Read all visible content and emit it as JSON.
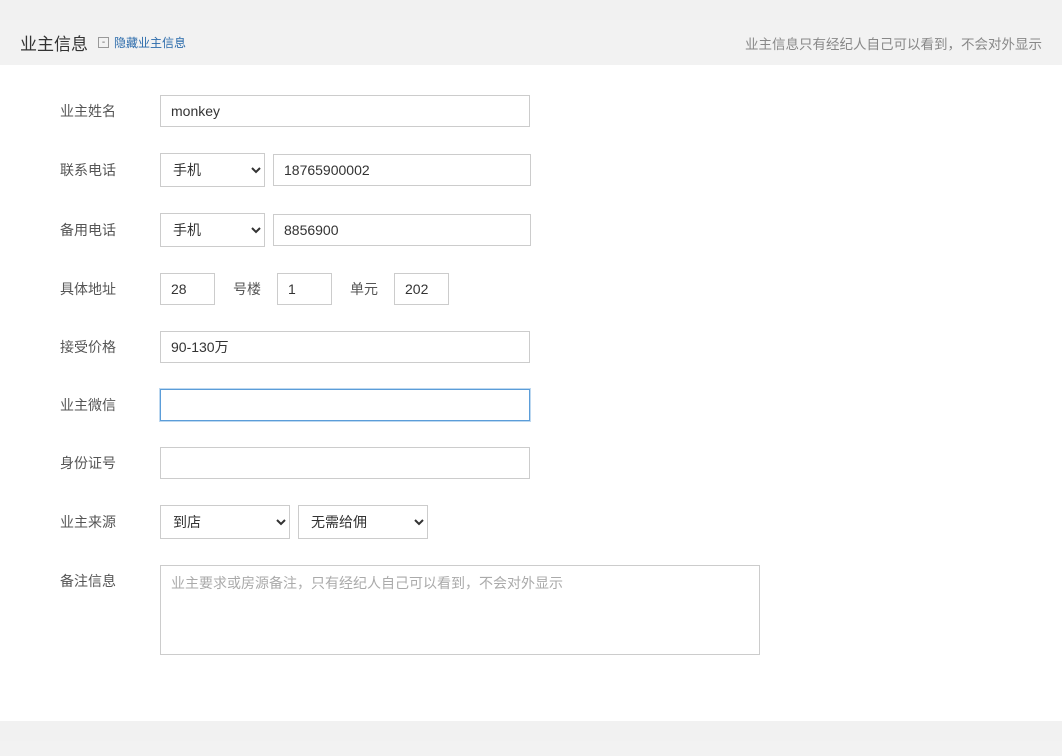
{
  "header": {
    "title": "业主信息",
    "toggle_symbol": "-",
    "toggle_text": "隐藏业主信息",
    "note": "业主信息只有经纪人自己可以看到，不会对外显示"
  },
  "form": {
    "name": {
      "label": "业主姓名",
      "value": "monkey"
    },
    "phone1": {
      "label": "联系电话",
      "type_selected": "手机",
      "value": "18765900002"
    },
    "phone2": {
      "label": "备用电话",
      "type_selected": "手机",
      "value": "8856900"
    },
    "address": {
      "label": "具体地址",
      "building": "28",
      "building_suffix": "号楼",
      "unit": "1",
      "unit_suffix": "单元",
      "room": "202"
    },
    "price": {
      "label": "接受价格",
      "value": "90-130万"
    },
    "wechat": {
      "label": "业主微信",
      "value": ""
    },
    "idcard": {
      "label": "身份证号",
      "value": ""
    },
    "source": {
      "label": "业主来源",
      "option1": "到店",
      "option2": "无需给佣"
    },
    "remark": {
      "label": "备注信息",
      "placeholder": "业主要求或房源备注，只有经纪人自己可以看到，不会对外显示",
      "value": ""
    }
  }
}
